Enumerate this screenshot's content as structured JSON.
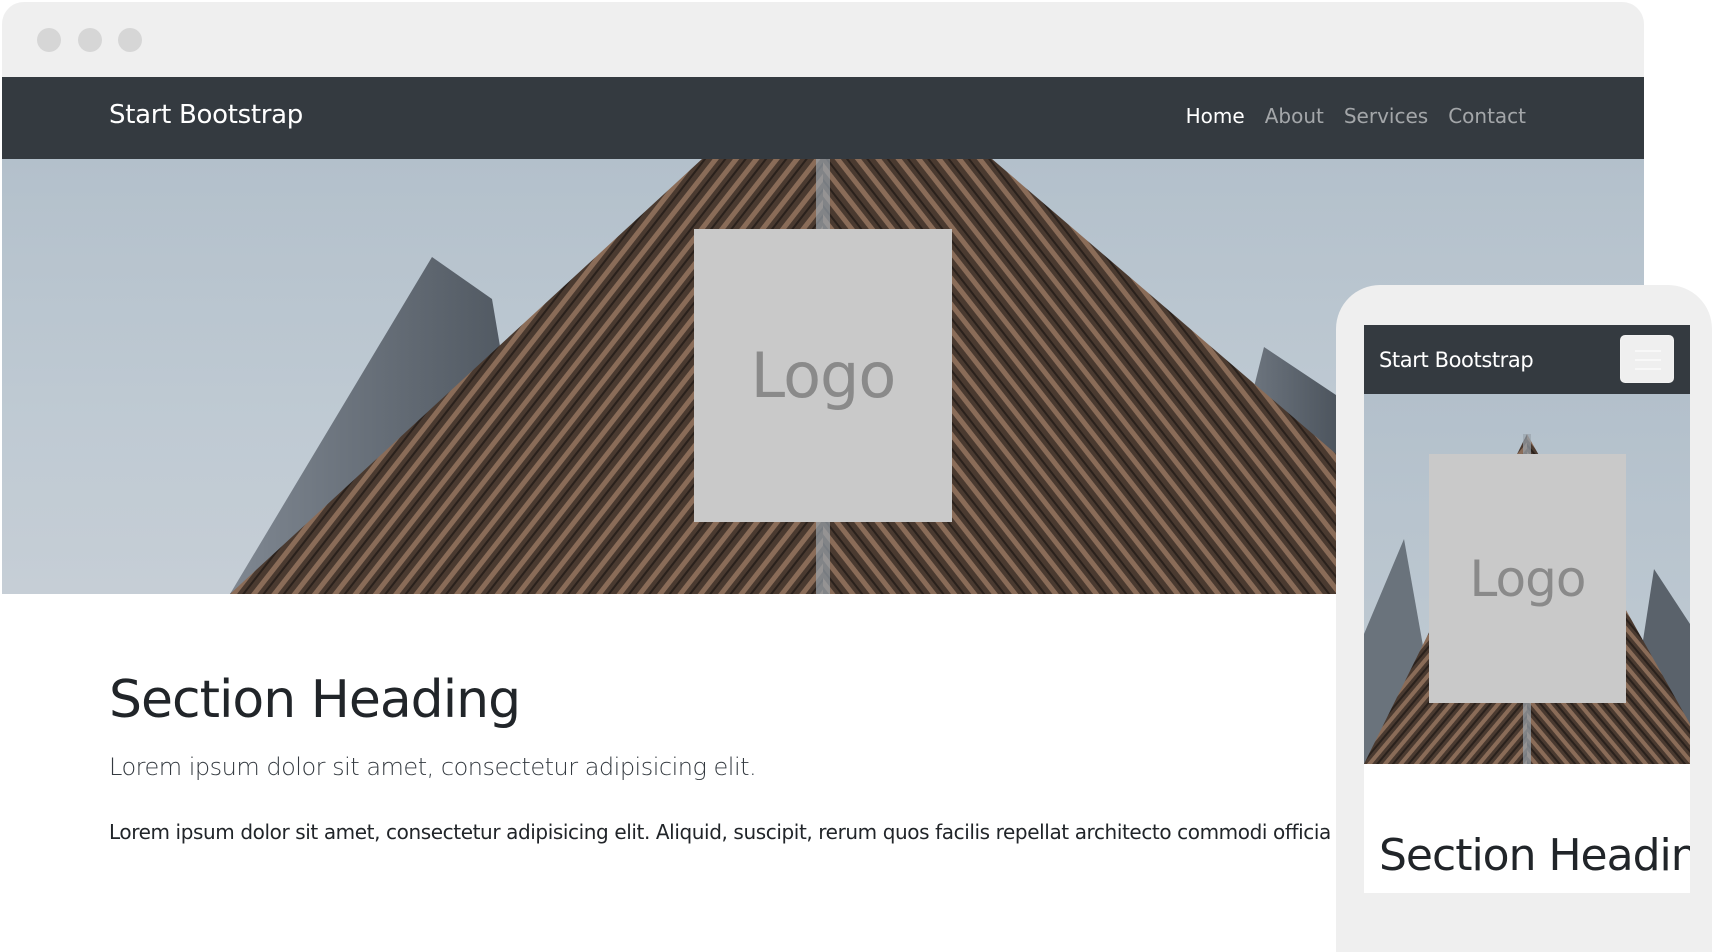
{
  "desktop": {
    "navbar": {
      "brand": "Start Bootstrap",
      "links": [
        "Home",
        "About",
        "Services",
        "Contact"
      ],
      "active": "Home"
    },
    "hero": {
      "logo_text": "Logo"
    },
    "content": {
      "heading": "Section Heading",
      "lead": "Lorem ipsum dolor sit amet, consectetur adipisicing elit.",
      "body": "Lorem ipsum dolor sit amet, consectetur adipisicing elit. Aliquid, suscipit, rerum quos facilis repellat architecto commodi officia atque ne"
    }
  },
  "mobile": {
    "navbar": {
      "brand": "Start Bootstrap"
    },
    "hero": {
      "logo_text": "Logo"
    },
    "content": {
      "heading": "Section Heading"
    }
  },
  "colors": {
    "navbar_bg": "#343a40",
    "mockup_frame": "#efefef",
    "logo_placeholder": "#c9c9c9"
  },
  "icons": [
    "window-dot-icon",
    "hamburger-menu-icon"
  ]
}
